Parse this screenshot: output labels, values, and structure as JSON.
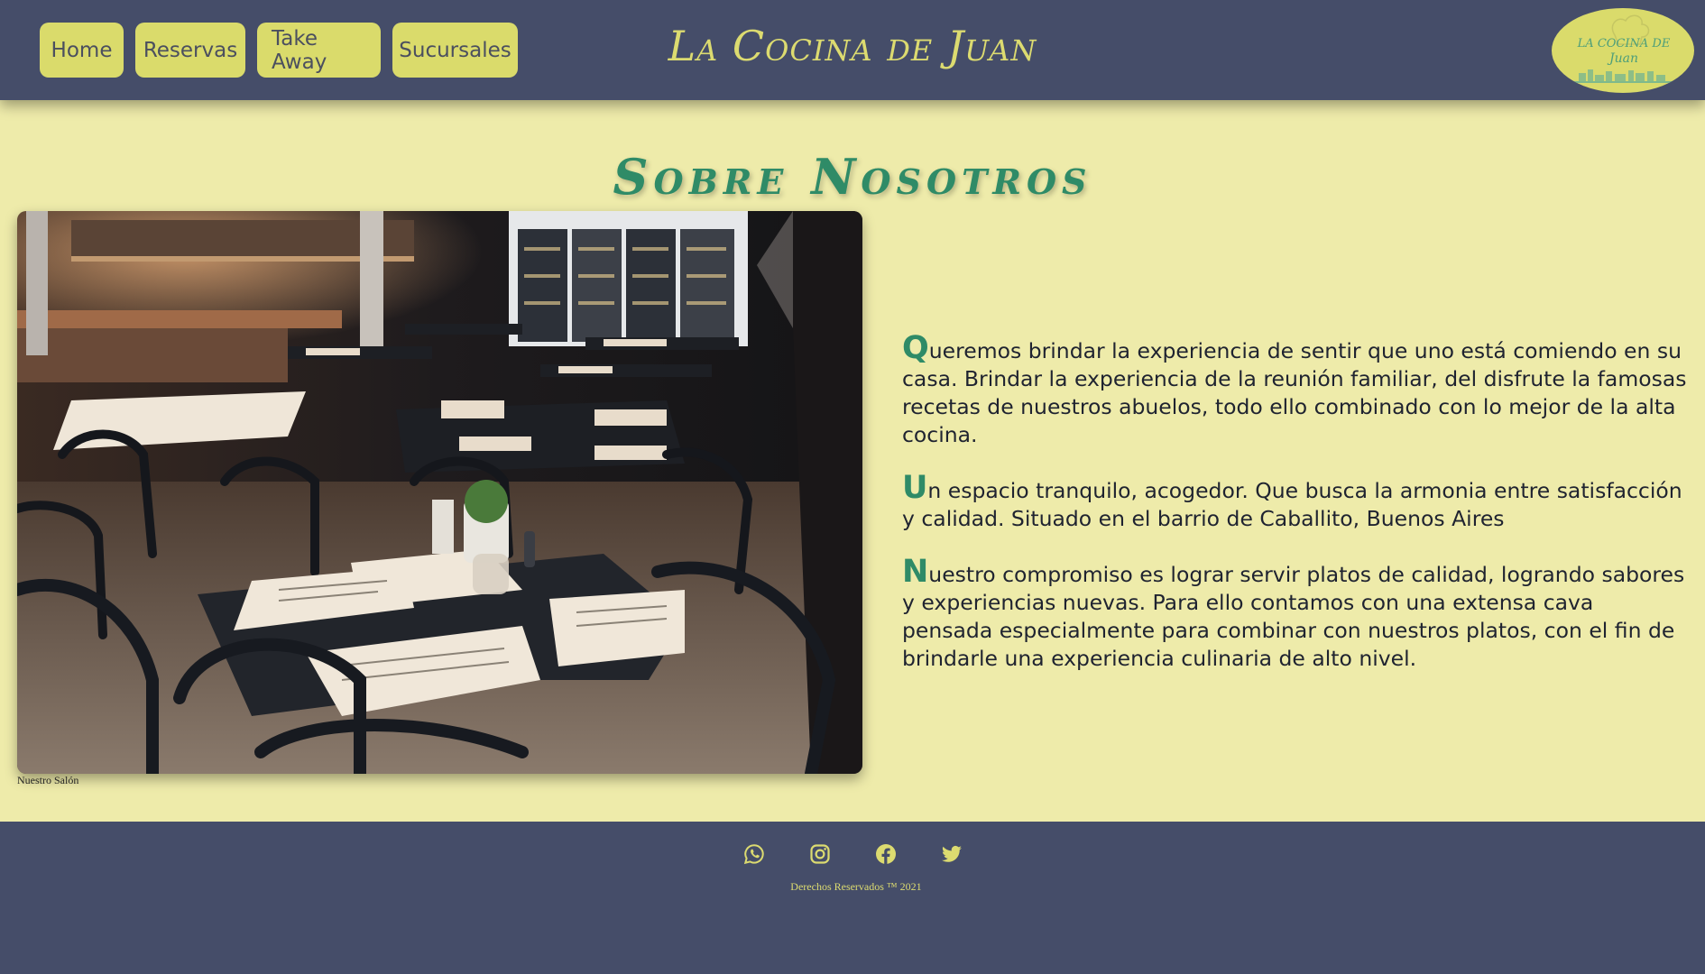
{
  "header": {
    "nav": [
      {
        "label": "Home"
      },
      {
        "label": "Reservas"
      },
      {
        "label": "Take Away"
      },
      {
        "label": "Sucursales"
      }
    ],
    "brand": "La Cocina de Juan",
    "logo_text": "La Cocina de Juan"
  },
  "main": {
    "title": "Sobre Nosotros",
    "image_caption": "Nuestro Salón",
    "paragraphs": [
      {
        "initial": "Q",
        "rest": "ueremos brindar la experiencia de sentir que uno está comiendo en su casa. Brindar la experiencia de la reunión familiar, del disfrute la famosas recetas de nuestros abuelos, todo ello combinado con lo mejor de la alta cocina."
      },
      {
        "initial": "U",
        "rest": "n espacio tranquilo, acogedor. Que busca la armonia entre satisfacción y calidad. Situado en el barrio de Caballito, Buenos Aires"
      },
      {
        "initial": "N",
        "rest": "uestro compromiso es lograr servir platos de calidad, logrando sabores y experiencias nuevas. Para ello contamos con una extensa cava pensada especialmente para combinar con nuestros platos, con el fin de brindarle una experiencia culinaria de alto nivel."
      }
    ]
  },
  "footer": {
    "social_icons": [
      "whatsapp-icon",
      "instagram-icon",
      "facebook-icon",
      "twitter-icon"
    ],
    "copyright": "Derechos Reservados ™ 2021"
  },
  "colors": {
    "header_bg": "#454d69",
    "page_bg": "#eeebaa",
    "accent_yellow": "#dadb6b",
    "accent_green": "#2f8b67"
  }
}
